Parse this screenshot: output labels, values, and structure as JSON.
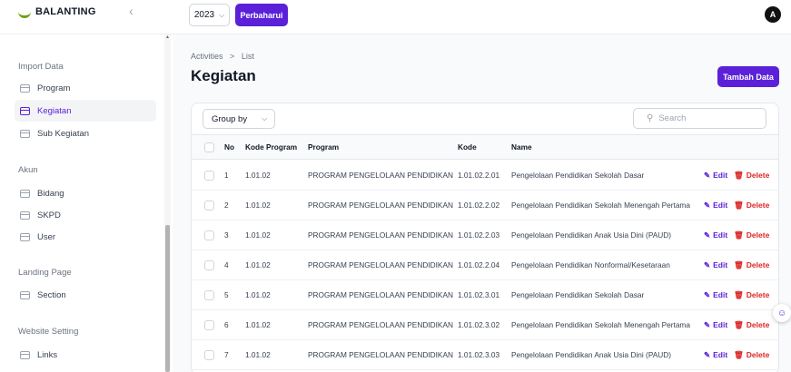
{
  "app": {
    "name": "BALANTING",
    "collapse_glyph": "‹"
  },
  "topbar": {
    "year": "2023",
    "refresh_label": "Perbaharui",
    "avatar_initial": "A"
  },
  "sidebar": {
    "groups": [
      {
        "label": "Import Data",
        "items": [
          {
            "label": "Program",
            "icon": "folder-icon"
          },
          {
            "label": "Kegiatan",
            "icon": "folder-icon",
            "active": true
          },
          {
            "label": "Sub Kegiatan",
            "icon": "folder-icon"
          }
        ]
      },
      {
        "label": "Akun",
        "items": [
          {
            "label": "Bidang",
            "icon": "folder-icon"
          },
          {
            "label": "SKPD",
            "icon": "folder-icon"
          },
          {
            "label": "User",
            "icon": "folder-icon"
          }
        ]
      },
      {
        "label": "Landing Page",
        "items": [
          {
            "label": "Section",
            "icon": "folder-icon"
          }
        ]
      },
      {
        "label": "Website Setting",
        "items": [
          {
            "label": "Links",
            "icon": "folder-icon"
          }
        ]
      }
    ]
  },
  "breadcrumb": {
    "first": "Activities",
    "sep": ">",
    "second": "List"
  },
  "page": {
    "title": "Kegiatan",
    "add_label": "Tambah Data"
  },
  "table": {
    "group_by_label": "Group by",
    "search_placeholder": "Search",
    "headers": {
      "no": "No",
      "kode_program": "Kode Program",
      "program": "Program",
      "kode": "Kode",
      "name": "Name"
    },
    "edit_label": "Edit",
    "delete_label": "Delete",
    "rows": [
      {
        "no": "1",
        "kode_program": "1.01.02",
        "program": "PROGRAM PENGELOLAAN PENDIDIKAN",
        "kode": "1.01.02.2.01",
        "name": "Pengelolaan Pendidikan Sekolah Dasar"
      },
      {
        "no": "2",
        "kode_program": "1.01.02",
        "program": "PROGRAM PENGELOLAAN PENDIDIKAN",
        "kode": "1.01.02.2.02",
        "name": "Pengelolaan Pendidikan Sekolah Menengah Pertama"
      },
      {
        "no": "3",
        "kode_program": "1.01.02",
        "program": "PROGRAM PENGELOLAAN PENDIDIKAN",
        "kode": "1.01.02.2.03",
        "name": "Pengelolaan Pendidikan Anak Usia Dini (PAUD)"
      },
      {
        "no": "4",
        "kode_program": "1.01.02",
        "program": "PROGRAM PENGELOLAAN PENDIDIKAN",
        "kode": "1.01.02.2.04",
        "name": "Pengelolaan Pendidikan Nonformal/Kesetaraan"
      },
      {
        "no": "5",
        "kode_program": "1.01.02",
        "program": "PROGRAM PENGELOLAAN PENDIDIKAN",
        "kode": "1.01.02.3.01",
        "name": "Pengelolaan Pendidikan Sekolah Dasar"
      },
      {
        "no": "6",
        "kode_program": "1.01.02",
        "program": "PROGRAM PENGELOLAAN PENDIDIKAN",
        "kode": "1.01.02.3.02",
        "name": "Pengelolaan Pendidikan Sekolah Menengah Pertama"
      },
      {
        "no": "7",
        "kode_program": "1.01.02",
        "program": "PROGRAM PENGELOLAAN PENDIDIKAN",
        "kode": "1.01.02.3.03",
        "name": "Pengelolaan Pendidikan Anak Usia Dini (PAUD)"
      }
    ]
  },
  "colors": {
    "primary": "#5b21d8",
    "danger": "#dc2626",
    "brand_mark": "#65a30d"
  }
}
